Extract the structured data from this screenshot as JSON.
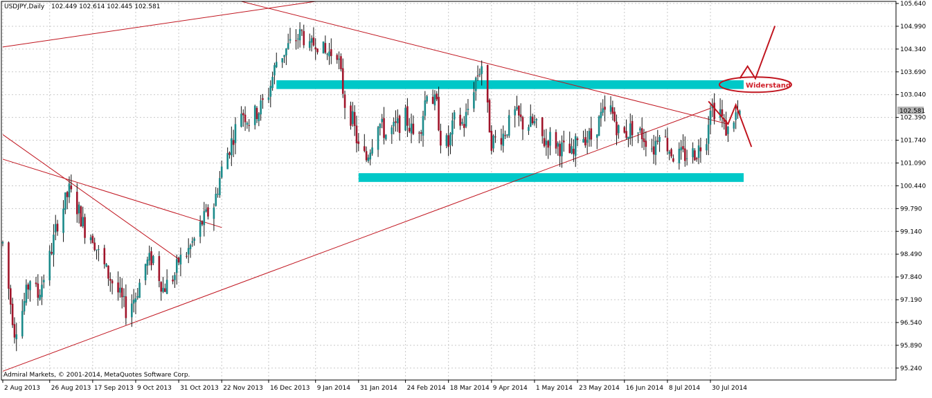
{
  "header": {
    "symbol": "USDJPY,Daily",
    "ohlc": "102.449 102.614 102.445 102.581"
  },
  "footer": {
    "copyright": "Admiral Markets, © 2001-2014, MetaQuotes Software Corp."
  },
  "price_tag": "102.581",
  "annotation": "Widerstand",
  "colors": {
    "bull_candle": "#1a8a8a",
    "bear_candle": "#a0142a",
    "wick": "#111111",
    "trendline": "#c0141e",
    "zone": "#00c8c8",
    "grid": "#c8c8c8",
    "price_tag_bg": "#b4b4b4"
  },
  "chart_data": {
    "type": "candlestick",
    "symbol": "USDJPY",
    "timeframe": "Daily",
    "last": {
      "open": 102.449,
      "high": 102.614,
      "low": 102.445,
      "close": 102.581
    },
    "ylim": [
      94.9,
      105.7
    ],
    "y_ticks": [
      "105.640",
      "104.990",
      "104.340",
      "103.690",
      "103.040",
      "102.390",
      "101.740",
      "101.090",
      "100.440",
      "99.790",
      "99.140",
      "98.490",
      "97.840",
      "97.190",
      "96.540",
      "95.890",
      "95.240"
    ],
    "x_ticks": [
      "2 Aug 2013",
      "26 Aug 2013",
      "17 Sep 2013",
      "9 Oct 2013",
      "31 Oct 2013",
      "22 Nov 2013",
      "16 Dec 2013",
      "9 Jan 2014",
      "31 Jan 2014",
      "24 Feb 2014",
      "18 Mar 2014",
      "9 Apr 2014",
      "1 May 2014",
      "23 May 2014",
      "16 Jun 2014",
      "8 Jul 2014",
      "30 Jul 2014"
    ],
    "grid": true,
    "zones": [
      {
        "label": "Widerstand",
        "from": 103.2,
        "to": 103.45,
        "start": "20 Dec 2013",
        "end": "16 Aug 2014"
      },
      {
        "label": "",
        "from": 100.55,
        "to": 100.8,
        "start": "31 Jan 2014",
        "end": "16 Aug 2014"
      }
    ],
    "trendlines": [
      {
        "from": [
          "2 Aug 2013",
          95.15
        ],
        "to": [
          "30 Jul 2014",
          102.65
        ]
      },
      {
        "from": [
          "2 Aug 2013",
          104.4
        ],
        "to": [
          "9 Jan 2014",
          105.7
        ]
      },
      {
        "from": [
          "2 Dec 2013",
          105.7
        ],
        "to": [
          "8 Aug 2014",
          102.2
        ]
      },
      {
        "from": [
          "2 Aug 2013",
          101.9
        ],
        "to": [
          "31 Oct 2013",
          98.35
        ]
      },
      {
        "from": [
          "2 Aug 2013",
          101.2
        ],
        "to": [
          "22 Nov 2013",
          99.25
        ]
      }
    ],
    "scenarios": [
      {
        "path": [
          [
            "29 Jul 2014",
            102.85
          ],
          [
            "8 Aug 2014",
            102.2
          ],
          [
            "12 Aug 2014",
            102.75
          ],
          [
            "20 Aug 2014",
            101.55
          ]
        ]
      },
      {
        "path": [
          [
            "14 Aug 2014",
            103.5
          ],
          [
            "18 Aug 2014",
            103.85
          ],
          [
            "22 Aug 2014",
            103.5
          ],
          [
            "1 Sep 2014",
            105.0
          ]
        ]
      }
    ],
    "series_keypoints": [
      [
        "2 Aug 2013",
        98.8
      ],
      [
        "5 Aug 2013",
        97.5
      ],
      [
        "8 Aug 2013",
        96.3
      ],
      [
        "12 Aug 2013",
        96.9
      ],
      [
        "16 Aug 2013",
        97.8
      ],
      [
        "20 Aug 2013",
        97.3
      ],
      [
        "26 Aug 2013",
        98.4
      ],
      [
        "30 Aug 2013",
        99.4
      ],
      [
        "5 Sep 2013",
        100.3
      ],
      [
        "10 Sep 2013",
        99.7
      ],
      [
        "13 Sep 2013",
        99.2
      ],
      [
        "17 Sep 2013",
        99.0
      ],
      [
        "20 Sep 2013",
        98.5
      ],
      [
        "24 Sep 2013",
        98.0
      ],
      [
        "30 Sep 2013",
        97.4
      ],
      [
        "4 Oct 2013",
        96.9
      ],
      [
        "9 Oct 2013",
        97.3
      ],
      [
        "14 Oct 2013",
        98.2
      ],
      [
        "18 Oct 2013",
        98.4
      ],
      [
        "23 Oct 2013",
        97.5
      ],
      [
        "29 Oct 2013",
        97.9
      ],
      [
        "31 Oct 2013",
        98.3
      ],
      [
        "4 Nov 2013",
        98.5
      ],
      [
        "8 Nov 2013",
        98.9
      ],
      [
        "12 Nov 2013",
        99.4
      ],
      [
        "18 Nov 2013",
        99.9
      ],
      [
        "22 Nov 2013",
        100.9
      ],
      [
        "27 Nov 2013",
        101.7
      ],
      [
        "2 Dec 2013",
        102.6
      ],
      [
        "6 Dec 2013",
        102.3
      ],
      [
        "11 Dec 2013",
        102.6
      ],
      [
        "16 Dec 2013",
        103.1
      ],
      [
        "20 Dec 2013",
        104.0
      ],
      [
        "26 Dec 2013",
        104.4
      ],
      [
        "2 Jan 2014",
        104.8
      ],
      [
        "6 Jan 2014",
        104.3
      ],
      [
        "9 Jan 2014",
        104.6
      ],
      [
        "14 Jan 2014",
        104.2
      ],
      [
        "20 Jan 2014",
        104.3
      ],
      [
        "24 Jan 2014",
        102.8
      ],
      [
        "28 Jan 2014",
        102.3
      ],
      [
        "31 Jan 2014",
        101.5
      ],
      [
        "4 Feb 2014",
        101.2
      ],
      [
        "10 Feb 2014",
        102.3
      ],
      [
        "14 Feb 2014",
        101.9
      ],
      [
        "19 Feb 2014",
        102.1
      ],
      [
        "24 Feb 2014",
        102.4
      ],
      [
        "28 Feb 2014",
        101.9
      ],
      [
        "4 Mar 2014",
        102.2
      ],
      [
        "7 Mar 2014",
        103.2
      ],
      [
        "12 Mar 2014",
        102.7
      ],
      [
        "14 Mar 2014",
        101.8
      ],
      [
        "18 Mar 2014",
        101.6
      ],
      [
        "21 Mar 2014",
        102.3
      ],
      [
        "26 Mar 2014",
        102.2
      ],
      [
        "1 Apr 2014",
        103.5
      ],
      [
        "4 Apr 2014",
        103.9
      ],
      [
        "9 Apr 2014",
        101.7
      ],
      [
        "15 Apr 2014",
        101.9
      ],
      [
        "21 Apr 2014",
        102.5
      ],
      [
        "25 Apr 2014",
        102.2
      ],
      [
        "1 May 2014",
        102.2
      ],
      [
        "6 May 2014",
        101.7
      ],
      [
        "9 May 2014",
        101.8
      ],
      [
        "15 May 2014",
        101.5
      ],
      [
        "21 May 2014",
        101.3
      ],
      [
        "23 May 2014",
        101.9
      ],
      [
        "30 May 2014",
        101.8
      ],
      [
        "4 Jun 2014",
        102.4
      ],
      [
        "9 Jun 2014",
        102.6
      ],
      [
        "13 Jun 2014",
        102.0
      ],
      [
        "16 Jun 2014",
        101.9
      ],
      [
        "20 Jun 2014",
        102.1
      ],
      [
        "25 Jun 2014",
        101.9
      ],
      [
        "1 Jul 2014",
        101.5
      ],
      [
        "4 Jul 2014",
        102.1
      ],
      [
        "8 Jul 2014",
        101.6
      ],
      [
        "11 Jul 2014",
        101.3
      ],
      [
        "17 Jul 2014",
        101.3
      ],
      [
        "23 Jul 2014",
        101.4
      ],
      [
        "28 Jul 2014",
        101.9
      ],
      [
        "30 Jul 2014",
        102.8
      ],
      [
        "1 Aug 2014",
        102.6
      ],
      [
        "4 Aug 2014",
        102.6
      ],
      [
        "6 Aug 2014",
        102.1
      ],
      [
        "8 Aug 2014",
        102.0
      ],
      [
        "11 Aug 2014",
        102.4
      ],
      [
        "13 Aug 2014",
        102.5
      ],
      [
        "14 Aug 2014",
        102.58
      ]
    ]
  }
}
